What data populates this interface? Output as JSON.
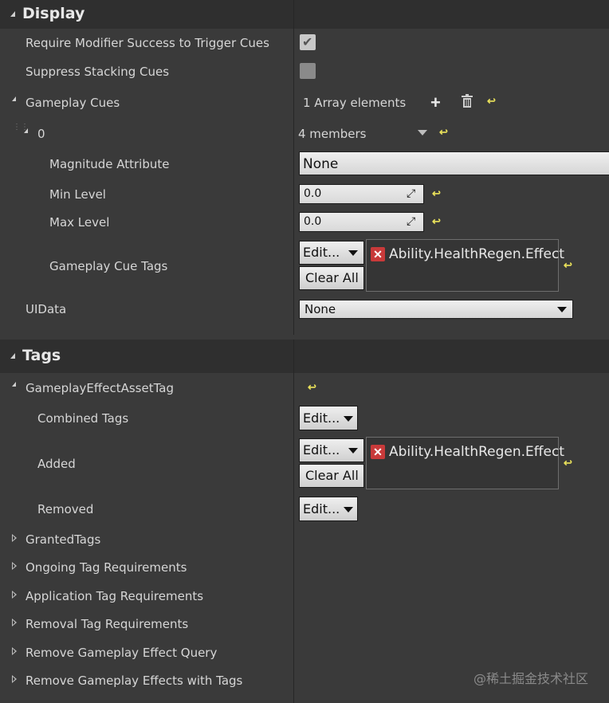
{
  "display": {
    "title": "Display",
    "require_modifier": "Require Modifier Success to Trigger Cues",
    "suppress_stacking": "Suppress Stacking Cues",
    "gameplay_cues": "Gameplay Cues",
    "array_count": "1 Array elements",
    "index0": "0",
    "members": "4 members",
    "magnitude_attribute": "Magnitude Attribute",
    "magnitude_value": "None",
    "min_level": "Min Level",
    "min_value": "0.0",
    "max_level": "Max Level",
    "max_value": "0.0",
    "cue_tags": "Gameplay Cue Tags",
    "edit": "Edit...",
    "clear_all": "Clear All",
    "cue_tag_value": "Ability.HealthRegen.Effect",
    "uidata": "UIData",
    "uidata_value": "None"
  },
  "tags": {
    "title": "Tags",
    "asset_tag": "GameplayEffectAssetTag",
    "combined": "Combined Tags",
    "added": "Added",
    "removed": "Removed",
    "edit": "Edit...",
    "clear_all": "Clear All",
    "added_tag_value": "Ability.HealthRegen.Effect",
    "collapsed": [
      "GrantedTags",
      "Ongoing Tag Requirements",
      "Application Tag Requirements",
      "Removal Tag Requirements",
      "Remove Gameplay Effect Query",
      "Remove Gameplay Effects with Tags"
    ]
  },
  "watermark": "@稀土掘金技术社区",
  "colors": {
    "accent_reset": "#e8e05a",
    "tag_remove": "#c83a3a",
    "panel": "#3a3a3a",
    "category": "#2f2f2f"
  }
}
